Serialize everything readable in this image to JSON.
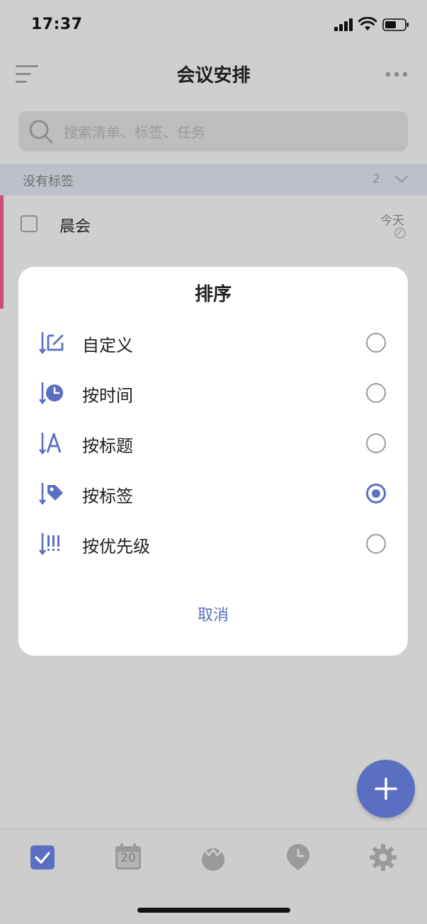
{
  "status_bar": {
    "time": "17:37"
  },
  "header": {
    "title": "会议安排"
  },
  "search": {
    "placeholder": "搜索清单、标签、任务"
  },
  "section": {
    "label": "没有标签",
    "count": "2"
  },
  "task": {
    "title": "晨会",
    "date": "今天"
  },
  "sort_dialog": {
    "title": "排序",
    "options": [
      {
        "label": "自定义",
        "icon": "custom-sort-icon",
        "selected": false
      },
      {
        "label": "按时间",
        "icon": "time-sort-icon",
        "selected": false
      },
      {
        "label": "按标题",
        "icon": "title-sort-icon",
        "selected": false
      },
      {
        "label": "按标签",
        "icon": "tag-sort-icon",
        "selected": true
      },
      {
        "label": "按优先级",
        "icon": "priority-sort-icon",
        "selected": false
      }
    ],
    "cancel_label": "取消"
  },
  "tabbar": {
    "calendar_day": "20",
    "tabs": [
      {
        "icon": "tasks-checkbox-icon",
        "active": true
      },
      {
        "icon": "calendar-icon",
        "active": false
      },
      {
        "icon": "habit-icon",
        "active": false
      },
      {
        "icon": "pomodoro-clock-icon",
        "active": false
      },
      {
        "icon": "settings-gear-icon",
        "active": false
      }
    ]
  },
  "colors": {
    "accent": "#5b6fc2",
    "tag_bar": "#c8507a",
    "overlay": "#cfcfcf"
  }
}
